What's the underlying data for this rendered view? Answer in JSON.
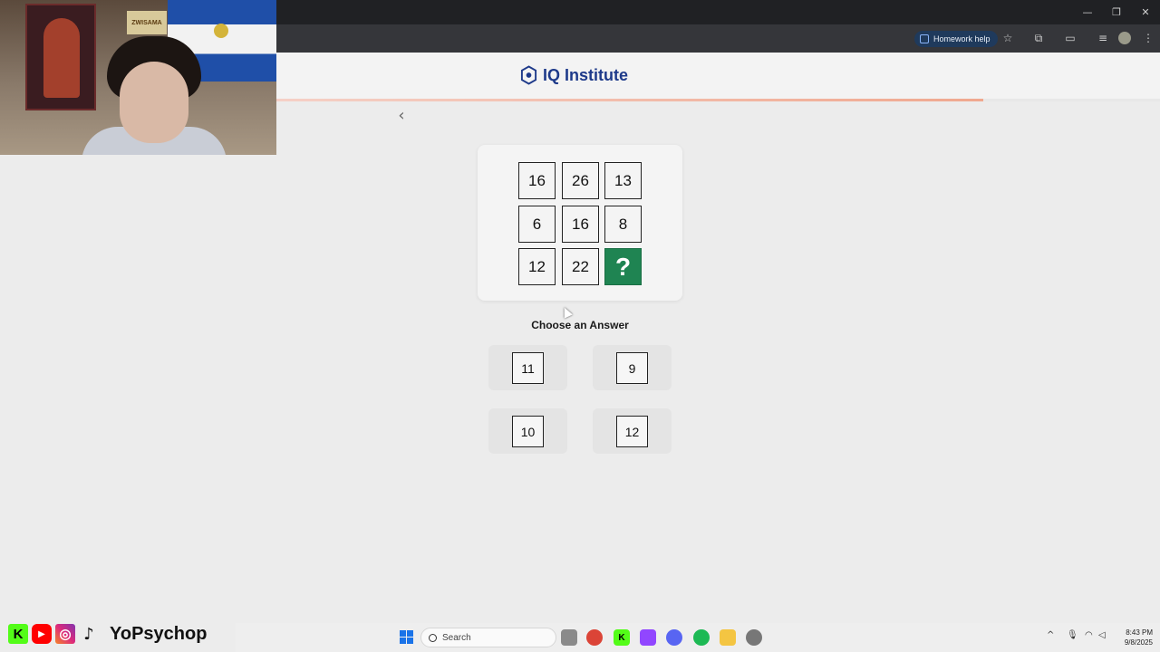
{
  "browser": {
    "homework_help_label": "Homework help",
    "window_controls": [
      "—",
      "❐",
      "✕"
    ]
  },
  "site": {
    "brand_name": "IQ Institute",
    "progress_percent": 80
  },
  "puzzle": {
    "grid": [
      [
        "16",
        "26",
        "13"
      ],
      [
        "6",
        "16",
        "8"
      ],
      [
        "12",
        "22",
        "?"
      ]
    ]
  },
  "answers": {
    "prompt": "Choose an Answer",
    "options": [
      "11",
      "9",
      "10",
      "12"
    ]
  },
  "webcam": {
    "sign_text": "ZWISAMA"
  },
  "stream_overlay": {
    "streamer_name": "YoPsychop"
  },
  "taskbar": {
    "search_placeholder": "Search",
    "time": "8:43 PM",
    "date": "9/8/2025"
  }
}
